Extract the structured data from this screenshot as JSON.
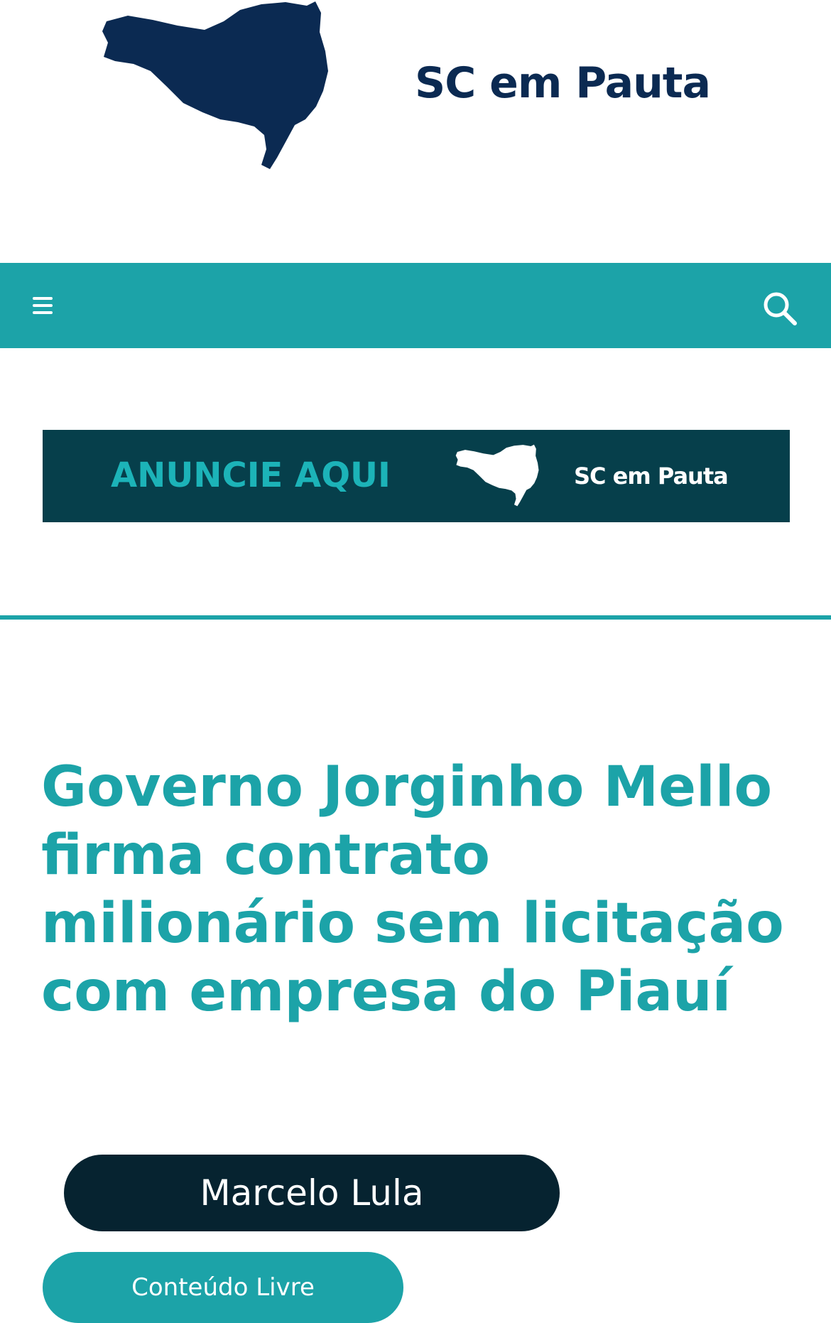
{
  "header": {
    "site_name": "SC em Pauta",
    "logo_icon": "santa-catarina-map-icon"
  },
  "nav": {
    "menu_icon": "hamburger-menu-icon",
    "search_icon": "search-icon",
    "background_color": "#1ca3a8"
  },
  "ad_banner": {
    "text": "ANUNCIE AQUI",
    "brand": "SC em Pauta",
    "background_color": "#063f4b"
  },
  "article": {
    "title": "Governo Jorginho Mello firma contrato milionário sem licitação com empresa do Piauí",
    "author": "Marcelo Lula",
    "category": "Conteúdo Livre"
  },
  "colors": {
    "accent": "#1ca3a8",
    "brand_dark": "#0b2a52",
    "author_pill": "#062330"
  }
}
